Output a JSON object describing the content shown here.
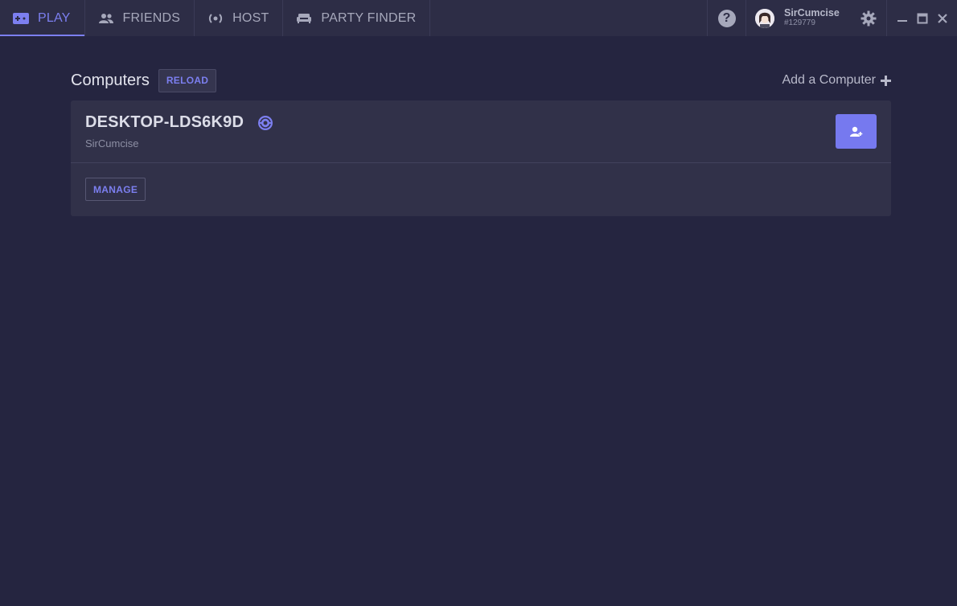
{
  "nav": {
    "tabs": [
      {
        "label": "PLAY",
        "icon": "gamepad-icon",
        "active": true
      },
      {
        "label": "FRIENDS",
        "icon": "friends-icon",
        "active": false
      },
      {
        "label": "HOST",
        "icon": "broadcast-icon",
        "active": false
      },
      {
        "label": "PARTY FINDER",
        "icon": "couch-icon",
        "active": false
      }
    ],
    "help_icon": "help-icon",
    "help_glyph": "?"
  },
  "user": {
    "name": "SirCumcise",
    "tag": "#129779",
    "avatar_icon": "avatar"
  },
  "window_controls": [
    "minimize-icon",
    "maximize-icon",
    "close-icon"
  ],
  "computers": {
    "title": "Computers",
    "reload_label": "RELOAD",
    "add_label": "Add a Computer",
    "items": [
      {
        "name": "DESKTOP-LDS6K9D",
        "owner": "SirCumcise",
        "manage_label": "MANAGE",
        "badge_icon": "host-icon",
        "action_icon": "add-user-icon"
      }
    ]
  },
  "colors": {
    "accent": "#7c7ff0",
    "background": "#252540",
    "topbar": "#2d2d46",
    "card": "#313149"
  }
}
